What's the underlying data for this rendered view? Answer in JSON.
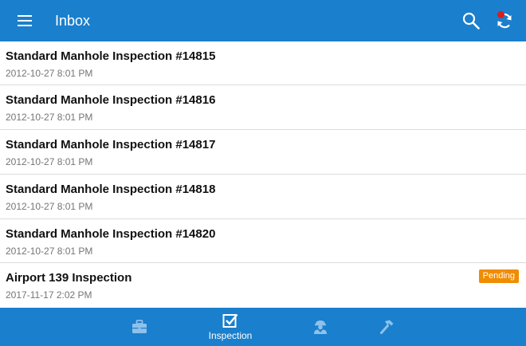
{
  "app_bar": {
    "title": "Inbox",
    "icons": [
      "menu-icon",
      "search-icon",
      "sync-icon"
    ],
    "sync_indicator_color": "#d32020"
  },
  "inbox": {
    "items": [
      {
        "title": "Standard Manhole Inspection #14815",
        "date": "2012-10-27 8:01 PM"
      },
      {
        "title": "Standard Manhole Inspection #14816",
        "date": "2012-10-27 8:01 PM"
      },
      {
        "title": "Standard Manhole Inspection #14817",
        "date": "2012-10-27 8:01 PM"
      },
      {
        "title": "Standard Manhole Inspection #14818",
        "date": "2012-10-27 8:01 PM"
      },
      {
        "title": "Standard Manhole Inspection #14820",
        "date": "2012-10-27 8:01 PM"
      },
      {
        "title": "Airport 139 Inspection",
        "date": "2017-11-17 2:02 PM",
        "status": "Pending"
      }
    ]
  },
  "bottom_nav": {
    "items": [
      {
        "icon": "briefcase-icon",
        "label": "",
        "active": false
      },
      {
        "icon": "checkbox-icon",
        "label": "Inspection",
        "active": true
      },
      {
        "icon": "worker-icon",
        "label": "",
        "active": false
      },
      {
        "icon": "hammer-icon",
        "label": "",
        "active": false
      }
    ]
  },
  "colors": {
    "primary": "#1a7fcc",
    "badge": "#f08c00",
    "inactive_icon": "#8fc1ea",
    "title_text": "#111111",
    "date_text": "#757575",
    "divider": "#dcdcdc"
  }
}
